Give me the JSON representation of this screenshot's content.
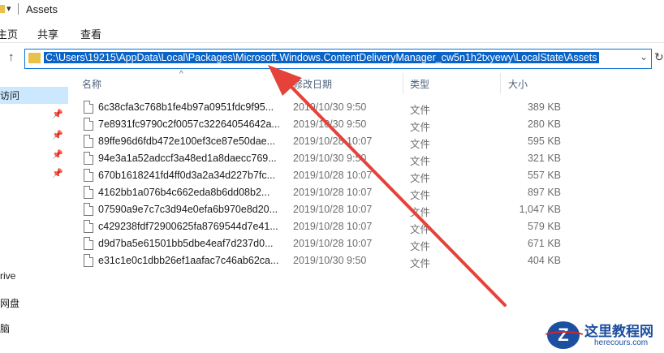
{
  "window": {
    "title": "Assets"
  },
  "ribbon": {
    "tabs": [
      "主页",
      "共享",
      "查看"
    ]
  },
  "address": {
    "path": "C:\\Users\\19215\\AppData\\Local\\Packages\\Microsoft.Windows.ContentDeliveryManager_cw5n1h2txyewy\\LocalState\\Assets"
  },
  "nav": {
    "items": [
      "访问",
      "rive",
      "网盘",
      "脑"
    ]
  },
  "columns": {
    "name": "名称",
    "date": "修改日期",
    "type": "类型",
    "size": "大小"
  },
  "files": [
    {
      "name": "6c38cfa3c768b1fe4b97a0951fdc9f95...",
      "date": "2019/10/30 9:50",
      "type": "文件",
      "size": "389 KB"
    },
    {
      "name": "7e8931fc9790c2f0057c32264054642a...",
      "date": "2019/10/30 9:50",
      "type": "文件",
      "size": "280 KB"
    },
    {
      "name": "89ffe96d6fdb472e100ef3ce87e50dae...",
      "date": "2019/10/28 10:07",
      "type": "文件",
      "size": "595 KB"
    },
    {
      "name": "94e3a1a52adccf3a48ed1a8daecc769...",
      "date": "2019/10/30 9:50",
      "type": "文件",
      "size": "321 KB"
    },
    {
      "name": "670b1618241fd4ff0d3a2a34d227b7fc...",
      "date": "2019/10/28 10:07",
      "type": "文件",
      "size": "557 KB"
    },
    {
      "name": "4162bb1a076b4c662eda8b6dd08b2...",
      "date": "2019/10/28 10:07",
      "type": "文件",
      "size": "897 KB"
    },
    {
      "name": "07590a9e7c7c3d94e0efa6b970e8d20...",
      "date": "2019/10/28 10:07",
      "type": "文件",
      "size": "1,047 KB"
    },
    {
      "name": "c429238fdf72900625fa8769544d7e41...",
      "date": "2019/10/28 10:07",
      "type": "文件",
      "size": "579 KB"
    },
    {
      "name": "d9d7ba5e61501bb5dbe4eaf7d237d0...",
      "date": "2019/10/28 10:07",
      "type": "文件",
      "size": "671 KB"
    },
    {
      "name": "e31c1e0c1dbb26ef1aafac7c46ab62ca...",
      "date": "2019/10/30 9:50",
      "type": "文件",
      "size": "404 KB"
    }
  ],
  "watermark": {
    "text": "这里教程网",
    "url": "herecours.com",
    "logo_letter": "Z"
  },
  "colors": {
    "selection": "#0a63c6",
    "annotation_arrow": "#e5423a",
    "nav_selected": "#cce8ff"
  }
}
